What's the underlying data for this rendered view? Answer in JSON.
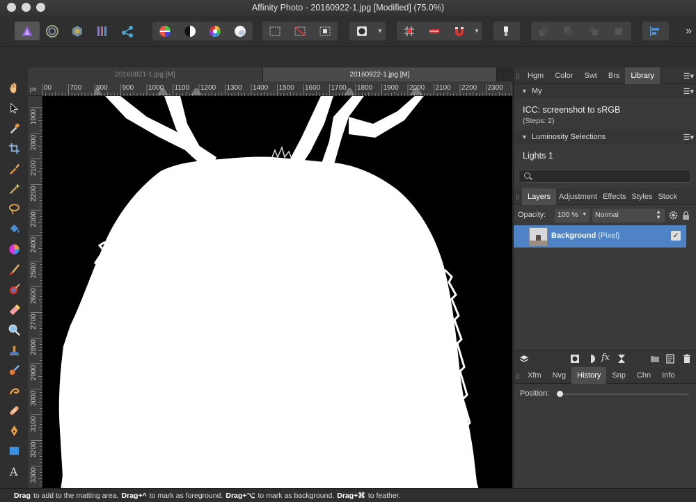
{
  "window": {
    "title": "Affinity Photo - 20160922-1.jpg [Modified] (75.0%)"
  },
  "toolbar": {
    "personas": [
      "photo-persona",
      "liquify-persona",
      "develop-persona",
      "tone-mapping-persona",
      "export-persona"
    ],
    "more_label": "»"
  },
  "document_tabs": [
    {
      "label": "20160821-1.jpg [M]",
      "active": false
    },
    {
      "label": "20160922-1.jpg [M]",
      "active": true
    }
  ],
  "ruler": {
    "unit": "px",
    "h_ticks": [
      "00",
      "700",
      "800",
      "900",
      "1000",
      "1100",
      "1200",
      "1300",
      "1400",
      "1500",
      "1600",
      "1700",
      "1800",
      "1900",
      "2000",
      "2100",
      "2200",
      "2300",
      "240"
    ],
    "v_ticks": [
      "1900",
      "2000",
      "2100",
      "2200",
      "2300",
      "2400",
      "2500",
      "2600",
      "2700",
      "2800",
      "2900",
      "3000",
      "3100",
      "3200",
      "3300"
    ]
  },
  "panels": {
    "top_tabs": [
      "Hgm",
      "Color",
      "Swt",
      "Brs",
      "Library"
    ],
    "top_active": "Library",
    "library": {
      "group1": "My",
      "macro_name": "ICC: screenshot to sRGB",
      "macro_steps": "(Steps: 2)",
      "group2": "Luminosity Selections",
      "item": "Lights 1"
    },
    "layers_tabs": [
      "Layers",
      "Adjustment",
      "Effects",
      "Styles",
      "Stock"
    ],
    "layers_active": "Layers",
    "opacity_label": "Opacity:",
    "opacity_value": "100 %",
    "blend_mode": "Normal",
    "layers": [
      {
        "name": "Background",
        "type": "(Pixel)",
        "visible": true
      }
    ],
    "bottom_tabs": [
      "Xfm",
      "Nvg",
      "History",
      "Snp",
      "Chn",
      "Info"
    ],
    "bottom_active": "History",
    "position_label": "Position:",
    "history_position": 0
  },
  "status": {
    "segments": [
      {
        "bold": "Drag",
        "text": "to add to the matting area."
      },
      {
        "bold": "Drag+^",
        "text": "to mark as foreground."
      },
      {
        "bold": "Drag+⌥",
        "text": "to mark as background."
      },
      {
        "bold": "Drag+⌘",
        "text": "to feather."
      }
    ]
  }
}
